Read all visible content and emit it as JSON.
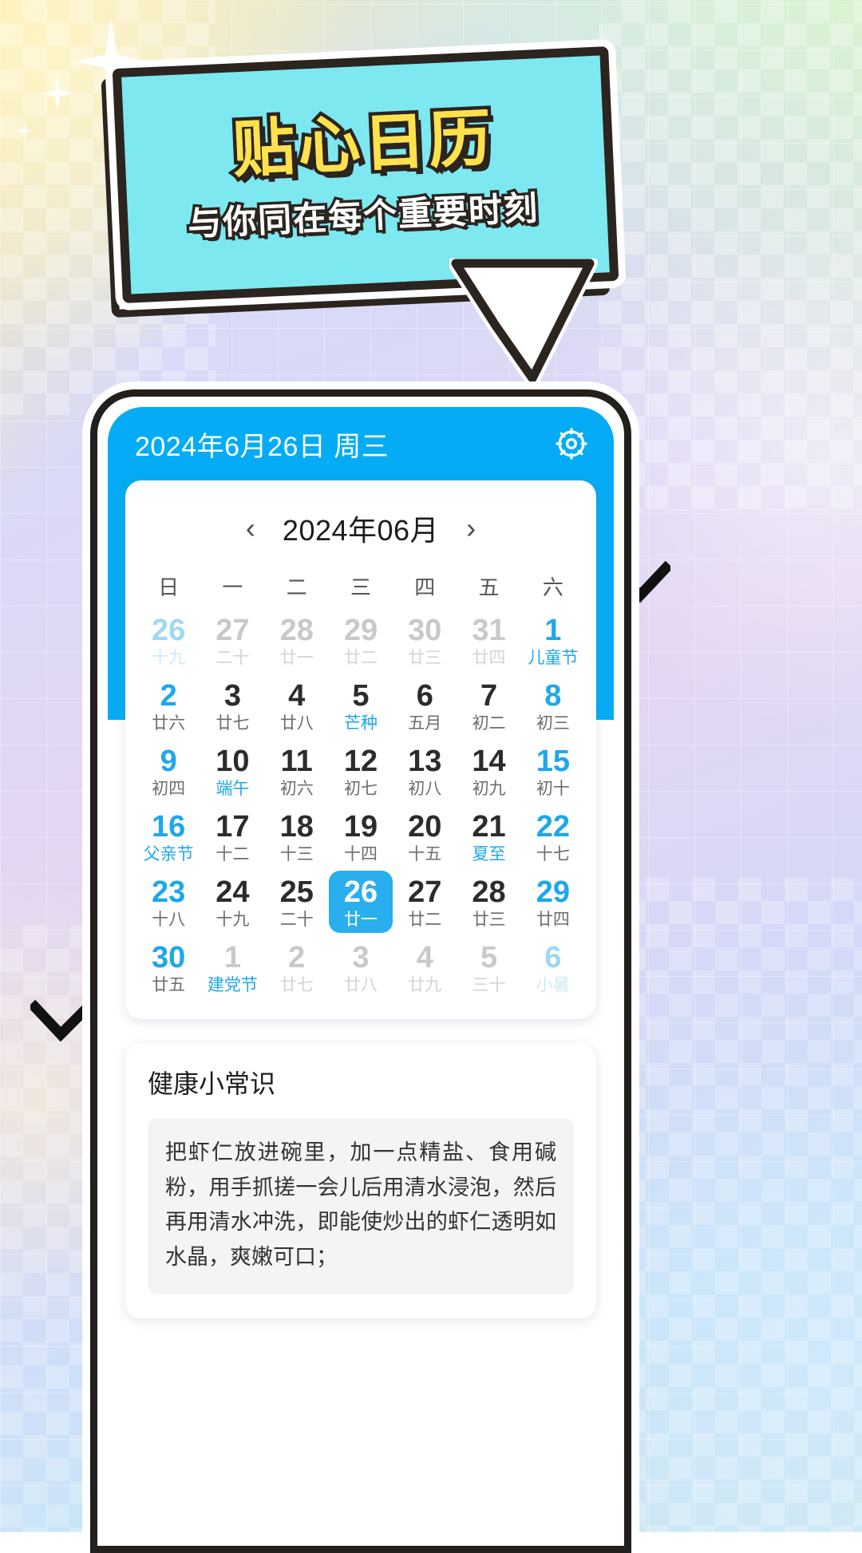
{
  "poster": {
    "title": "贴心日历",
    "subtitle": "与你同在每个重要时刻",
    "title_color": "#FFE14D",
    "banner_color": "#7DE8F0",
    "outline_color": "#2b241f"
  },
  "app": {
    "accent_color": "#05ACF5",
    "header": {
      "date_text": "2024年6月26日 周三",
      "settings_icon": "gear-icon"
    },
    "calendar": {
      "prev_label": "‹",
      "next_label": "›",
      "month_label": "2024年06月",
      "weekdays": [
        "日",
        "一",
        "二",
        "三",
        "四",
        "五",
        "六"
      ],
      "weeks": [
        [
          {
            "day": "26",
            "lunar": "十九",
            "out": true,
            "weekend": true,
            "fest": false,
            "sel": false
          },
          {
            "day": "27",
            "lunar": "二十",
            "out": true,
            "weekend": false,
            "fest": false,
            "sel": false
          },
          {
            "day": "28",
            "lunar": "廿一",
            "out": true,
            "weekend": false,
            "fest": false,
            "sel": false
          },
          {
            "day": "29",
            "lunar": "廿二",
            "out": true,
            "weekend": false,
            "fest": false,
            "sel": false
          },
          {
            "day": "30",
            "lunar": "廿三",
            "out": true,
            "weekend": false,
            "fest": false,
            "sel": false
          },
          {
            "day": "31",
            "lunar": "廿四",
            "out": true,
            "weekend": false,
            "fest": false,
            "sel": false
          },
          {
            "day": "1",
            "lunar": "儿童节",
            "out": false,
            "weekend": true,
            "fest": true,
            "sel": false
          }
        ],
        [
          {
            "day": "2",
            "lunar": "廿六",
            "out": false,
            "weekend": true,
            "fest": false,
            "sel": false
          },
          {
            "day": "3",
            "lunar": "廿七",
            "out": false,
            "weekend": false,
            "fest": false,
            "sel": false
          },
          {
            "day": "4",
            "lunar": "廿八",
            "out": false,
            "weekend": false,
            "fest": false,
            "sel": false
          },
          {
            "day": "5",
            "lunar": "芒种",
            "out": false,
            "weekend": false,
            "fest": true,
            "sel": false
          },
          {
            "day": "6",
            "lunar": "五月",
            "out": false,
            "weekend": false,
            "fest": false,
            "sel": false
          },
          {
            "day": "7",
            "lunar": "初二",
            "out": false,
            "weekend": false,
            "fest": false,
            "sel": false
          },
          {
            "day": "8",
            "lunar": "初三",
            "out": false,
            "weekend": true,
            "fest": false,
            "sel": false
          }
        ],
        [
          {
            "day": "9",
            "lunar": "初四",
            "out": false,
            "weekend": true,
            "fest": false,
            "sel": false
          },
          {
            "day": "10",
            "lunar": "端午",
            "out": false,
            "weekend": false,
            "fest": true,
            "sel": false
          },
          {
            "day": "11",
            "lunar": "初六",
            "out": false,
            "weekend": false,
            "fest": false,
            "sel": false
          },
          {
            "day": "12",
            "lunar": "初七",
            "out": false,
            "weekend": false,
            "fest": false,
            "sel": false
          },
          {
            "day": "13",
            "lunar": "初八",
            "out": false,
            "weekend": false,
            "fest": false,
            "sel": false
          },
          {
            "day": "14",
            "lunar": "初九",
            "out": false,
            "weekend": false,
            "fest": false,
            "sel": false
          },
          {
            "day": "15",
            "lunar": "初十",
            "out": false,
            "weekend": true,
            "fest": false,
            "sel": false
          }
        ],
        [
          {
            "day": "16",
            "lunar": "父亲节",
            "out": false,
            "weekend": true,
            "fest": true,
            "sel": false
          },
          {
            "day": "17",
            "lunar": "十二",
            "out": false,
            "weekend": false,
            "fest": false,
            "sel": false
          },
          {
            "day": "18",
            "lunar": "十三",
            "out": false,
            "weekend": false,
            "fest": false,
            "sel": false
          },
          {
            "day": "19",
            "lunar": "十四",
            "out": false,
            "weekend": false,
            "fest": false,
            "sel": false
          },
          {
            "day": "20",
            "lunar": "十五",
            "out": false,
            "weekend": false,
            "fest": false,
            "sel": false
          },
          {
            "day": "21",
            "lunar": "夏至",
            "out": false,
            "weekend": false,
            "fest": true,
            "sel": false
          },
          {
            "day": "22",
            "lunar": "十七",
            "out": false,
            "weekend": true,
            "fest": false,
            "sel": false
          }
        ],
        [
          {
            "day": "23",
            "lunar": "十八",
            "out": false,
            "weekend": true,
            "fest": false,
            "sel": false
          },
          {
            "day": "24",
            "lunar": "十九",
            "out": false,
            "weekend": false,
            "fest": false,
            "sel": false
          },
          {
            "day": "25",
            "lunar": "二十",
            "out": false,
            "weekend": false,
            "fest": false,
            "sel": false
          },
          {
            "day": "26",
            "lunar": "廿一",
            "out": false,
            "weekend": false,
            "fest": false,
            "sel": true
          },
          {
            "day": "27",
            "lunar": "廿二",
            "out": false,
            "weekend": false,
            "fest": false,
            "sel": false
          },
          {
            "day": "28",
            "lunar": "廿三",
            "out": false,
            "weekend": false,
            "fest": false,
            "sel": false
          },
          {
            "day": "29",
            "lunar": "廿四",
            "out": false,
            "weekend": true,
            "fest": false,
            "sel": false
          }
        ],
        [
          {
            "day": "30",
            "lunar": "廿五",
            "out": false,
            "weekend": true,
            "fest": false,
            "sel": false
          },
          {
            "day": "1",
            "lunar": "建党节",
            "out": true,
            "weekend": false,
            "fest": true,
            "sel": false
          },
          {
            "day": "2",
            "lunar": "廿七",
            "out": true,
            "weekend": false,
            "fest": false,
            "sel": false
          },
          {
            "day": "3",
            "lunar": "廿八",
            "out": true,
            "weekend": false,
            "fest": false,
            "sel": false
          },
          {
            "day": "4",
            "lunar": "廿九",
            "out": true,
            "weekend": false,
            "fest": false,
            "sel": false
          },
          {
            "day": "5",
            "lunar": "三十",
            "out": true,
            "weekend": false,
            "fest": false,
            "sel": false
          },
          {
            "day": "6",
            "lunar": "小暑",
            "out": true,
            "weekend": true,
            "fest": true,
            "sel": false
          }
        ]
      ]
    },
    "tip": {
      "title": "健康小常识",
      "body": "把虾仁放进碗里，加一点精盐、食用碱粉，用手抓搓一会儿后用清水浸泡，然后再用清水冲洗，即能使炒出的虾仁透明如水晶，爽嫩可口；"
    }
  }
}
